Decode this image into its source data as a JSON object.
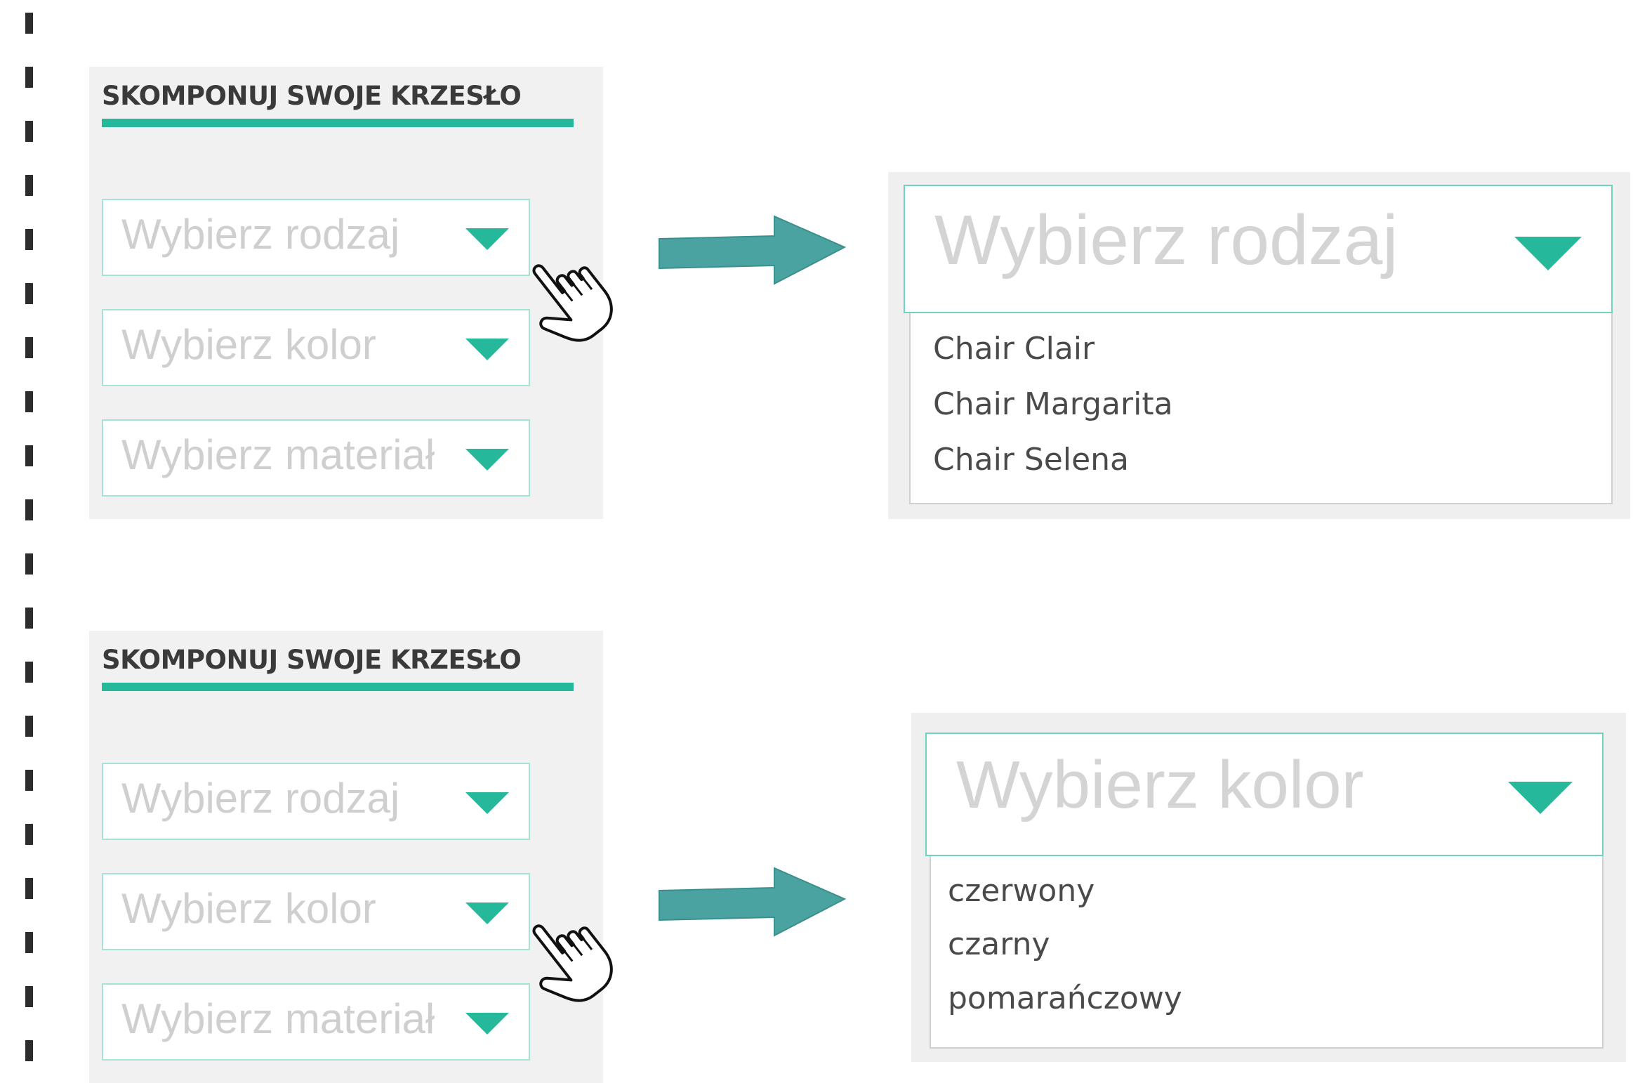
{
  "colors": {
    "accent": "#26b89b",
    "arrow": "#4aa3a0",
    "panel_bg": "#f1f1f1"
  },
  "top_section": {
    "title": "SKOMPONUJ SWOJE KRZESŁO",
    "selects": [
      "Wybierz rodzaj",
      "Wybierz kolor",
      "Wybierz materiał"
    ],
    "expanded": {
      "placeholder": "Wybierz rodzaj",
      "options": [
        "Chair Clair",
        "Chair Margarita",
        "Chair Selena"
      ]
    }
  },
  "bottom_section": {
    "title": "SKOMPONUJ SWOJE KRZESŁO",
    "selects": [
      "Wybierz rodzaj",
      "Wybierz kolor",
      "Wybierz materiał"
    ],
    "expanded": {
      "placeholder": "Wybierz kolor",
      "options": [
        "czerwony",
        "czarny",
        "pomarańczowy"
      ]
    }
  },
  "icons": {
    "cursor": "hand-pointer-icon",
    "arrow": "arrow-right-icon",
    "caret": "caret-down-icon"
  }
}
